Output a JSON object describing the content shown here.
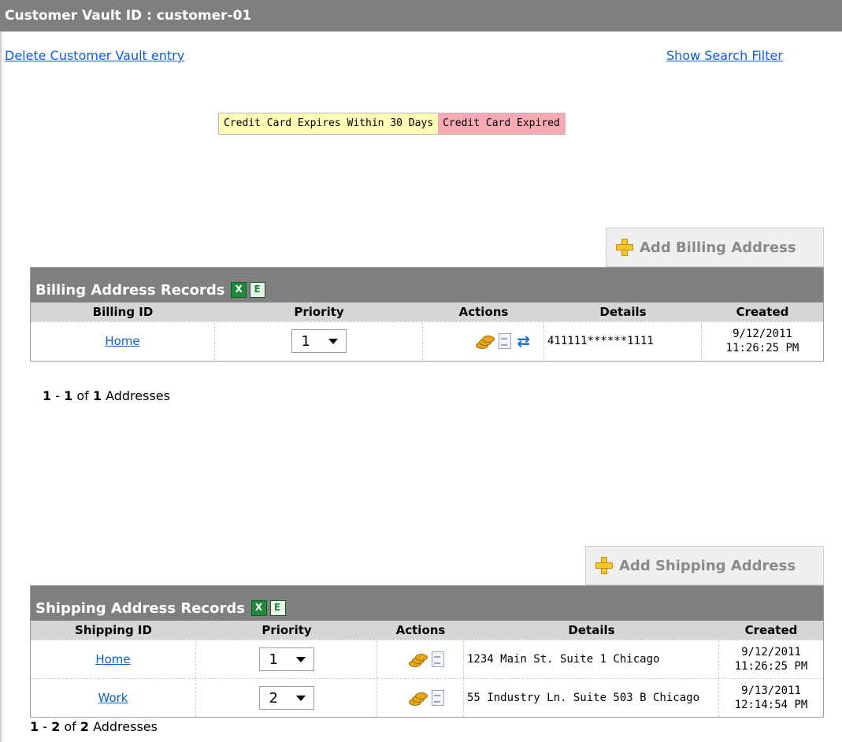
{
  "title": "Customer Vault ID : customer-01",
  "links": {
    "delete": "Delete Customer Vault entry",
    "filter": "Show Search Filter"
  },
  "legend": {
    "expiring": "Credit Card Expires Within 30 Days",
    "expired": "Credit Card Expired"
  },
  "billing": {
    "add_label": "Add Billing Address",
    "title": "Billing Address Records",
    "headers": [
      "Billing ID",
      "Priority",
      "Actions",
      "Details",
      "Created"
    ],
    "rows": [
      {
        "id": "Home",
        "priority": "1",
        "details": "411111******1111",
        "created_date": "9/12/2011",
        "created_time": "11:26:25 PM"
      }
    ],
    "pager": {
      "from": "1",
      "to": "1",
      "total": "1",
      "of": "of",
      "unit": "Addresses"
    }
  },
  "shipping": {
    "add_label": "Add Shipping Address",
    "title": "Shipping Address Records",
    "headers": [
      "Shipping ID",
      "Priority",
      "Actions",
      "Details",
      "Created"
    ],
    "rows": [
      {
        "id": "Home",
        "priority": "1",
        "details": "1234 Main St. Suite 1 Chicago",
        "created_date": "9/12/2011",
        "created_time": "11:26:25 PM"
      },
      {
        "id": "Work",
        "priority": "2",
        "details": "55 Industry Ln. Suite 503 B Chicago",
        "created_date": "9/13/2011",
        "created_time": "12:14:54 PM"
      }
    ],
    "pager": {
      "from": "1",
      "to": "2",
      "total": "2",
      "of": "of",
      "unit": "Addresses"
    }
  },
  "colors": {
    "header_bar": "#7f7f7f",
    "link": "#0b5fd0",
    "expiring": "#fdfbb6",
    "expired": "#f8a9b4"
  },
  "icons": [
    "plus-icon",
    "excel-export-icon",
    "excel-download-icon",
    "charge-coins-icon",
    "details-doc-icon",
    "sync-icon",
    "chevron-down-icon"
  ]
}
